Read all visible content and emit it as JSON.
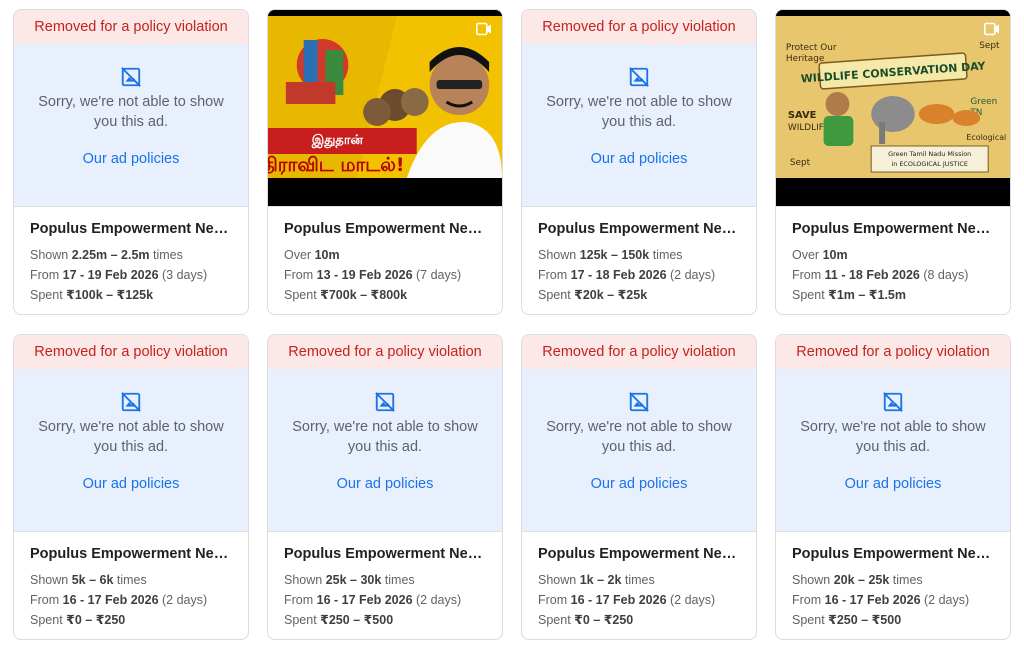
{
  "removed": {
    "banner": "Removed for a policy violation",
    "sorry": "Sorry, we're not able to show you this ad.",
    "link": "Our ad policies"
  },
  "cards": [
    {
      "type": "removed",
      "advertiser": "Populus Empowerment Netw...",
      "l1_pre": "Shown ",
      "l1_b": "2.25m – 2.5m",
      "l1_post": " times",
      "l2_pre": "From ",
      "l2_b": "17 - 19 Feb 2026",
      "l2_post": " (3 days)",
      "l3_pre": "Spent ",
      "l3_b": "₹100k – ₹125k"
    },
    {
      "type": "video",
      "thumb": "dravidian",
      "thumb_text": "இதுதான் திராவிட மாடல்!",
      "advertiser": "Populus Empowerment Netw...",
      "l1_pre": "Over ",
      "l1_b": "10m",
      "l1_post": "",
      "l2_pre": "From ",
      "l2_b": "13 - 19 Feb 2026",
      "l2_post": " (7 days)",
      "l3_pre": "Spent ",
      "l3_b": "₹700k – ₹800k"
    },
    {
      "type": "removed",
      "advertiser": "Populus Empowerment Netw...",
      "l1_pre": "Shown ",
      "l1_b": "125k – 150k",
      "l1_post": " times",
      "l2_pre": "From ",
      "l2_b": "17 - 18 Feb 2026",
      "l2_post": " (2 days)",
      "l3_pre": "Spent ",
      "l3_b": "₹20k – ₹25k"
    },
    {
      "type": "video",
      "thumb": "wildlife",
      "thumb_text": "WILDLIFE CONSERVATION DAY",
      "advertiser": "Populus Empowerment Netw...",
      "l1_pre": "Over ",
      "l1_b": "10m",
      "l1_post": "",
      "l2_pre": "From ",
      "l2_b": "11 - 18 Feb 2026",
      "l2_post": " (8 days)",
      "l3_pre": "Spent ",
      "l3_b": "₹1m – ₹1.5m"
    },
    {
      "type": "removed",
      "advertiser": "Populus Empowerment Netw...",
      "l1_pre": "Shown ",
      "l1_b": "5k – 6k",
      "l1_post": " times",
      "l2_pre": "From ",
      "l2_b": "16 - 17 Feb 2026",
      "l2_post": " (2 days)",
      "l3_pre": "Spent ",
      "l3_b": "₹0 – ₹250"
    },
    {
      "type": "removed",
      "advertiser": "Populus Empowerment Netw...",
      "l1_pre": "Shown ",
      "l1_b": "25k – 30k",
      "l1_post": " times",
      "l2_pre": "From ",
      "l2_b": "16 - 17 Feb 2026",
      "l2_post": " (2 days)",
      "l3_pre": "Spent ",
      "l3_b": "₹250 – ₹500"
    },
    {
      "type": "removed",
      "advertiser": "Populus Empowerment Netw...",
      "l1_pre": "Shown ",
      "l1_b": "1k – 2k",
      "l1_post": " times",
      "l2_pre": "From ",
      "l2_b": "16 - 17 Feb 2026",
      "l2_post": " (2 days)",
      "l3_pre": "Spent ",
      "l3_b": "₹0 – ₹250"
    },
    {
      "type": "removed",
      "advertiser": "Populus Empowerment Netw...",
      "l1_pre": "Shown ",
      "l1_b": "20k – 25k",
      "l1_post": " times",
      "l2_pre": "From ",
      "l2_b": "16 - 17 Feb 2026",
      "l2_post": " (2 days)",
      "l3_pre": "Spent ",
      "l3_b": "₹250 – ₹500"
    }
  ]
}
